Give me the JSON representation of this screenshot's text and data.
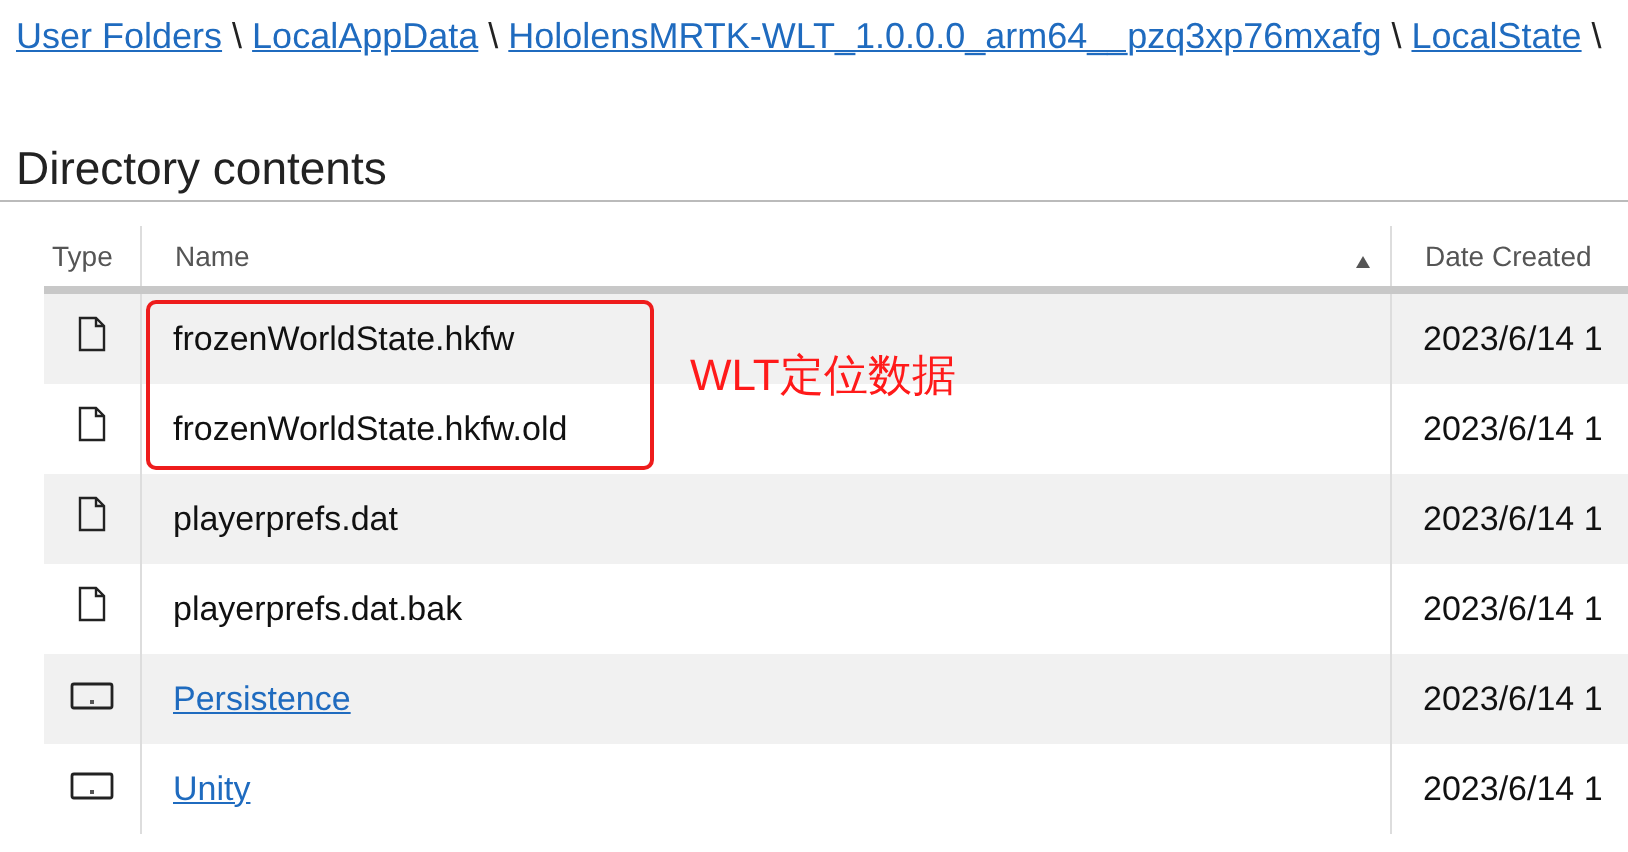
{
  "breadcrumbs": [
    {
      "label": "User Folders"
    },
    {
      "label": "LocalAppData"
    },
    {
      "label": "HololensMRTK-WLT_1.0.0.0_arm64__pzq3xp76mxafg"
    },
    {
      "label": "LocalState"
    }
  ],
  "separator": "\\",
  "heading": "Directory contents",
  "table": {
    "columns": [
      {
        "label": "Type",
        "sorted": false
      },
      {
        "label": "Name",
        "sorted": true
      },
      {
        "label": "Date Created",
        "sorted": false
      }
    ],
    "rows": [
      {
        "kind": "file",
        "name": "frozenWorldState.hkfw",
        "date": "2023/6/14 1",
        "annotated": true
      },
      {
        "kind": "file",
        "name": "frozenWorldState.hkfw.old",
        "date": "2023/6/14 1",
        "annotated": true
      },
      {
        "kind": "file",
        "name": "playerprefs.dat",
        "date": "2023/6/14 1",
        "annotated": false
      },
      {
        "kind": "file",
        "name": "playerprefs.dat.bak",
        "date": "2023/6/14 1",
        "annotated": false
      },
      {
        "kind": "folder",
        "name": "Persistence",
        "date": "2023/6/14 1",
        "annotated": false
      },
      {
        "kind": "folder",
        "name": "Unity",
        "date": "2023/6/14 1",
        "annotated": false
      }
    ]
  },
  "annotation": {
    "text": "WLT定位数据"
  }
}
